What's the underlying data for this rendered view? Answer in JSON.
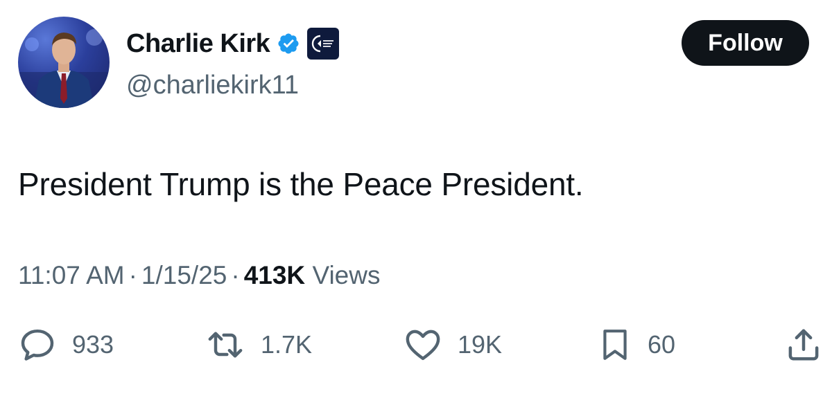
{
  "author": {
    "display_name": "Charlie Kirk",
    "handle": "@charliekirk11",
    "verified": true,
    "affiliate_badge": "turning-point-usa-logo"
  },
  "follow_button": {
    "label": "Follow"
  },
  "tweet": {
    "text": "President Trump is the Peace President.",
    "time": "11:07 AM",
    "date": "1/15/25",
    "views_count": "413K",
    "views_label": "Views",
    "separator": "·"
  },
  "actions": {
    "replies": {
      "icon": "reply-icon",
      "count": "933"
    },
    "reposts": {
      "icon": "retweet-icon",
      "count": "1.7K"
    },
    "likes": {
      "icon": "heart-icon",
      "count": "19K"
    },
    "bookmarks": {
      "icon": "bookmark-icon",
      "count": "60"
    },
    "share": {
      "icon": "share-icon"
    }
  },
  "colors": {
    "text_primary": "#0f1419",
    "text_secondary": "#536471",
    "verified_blue": "#1d9bf0",
    "follow_bg": "#0f1419"
  }
}
